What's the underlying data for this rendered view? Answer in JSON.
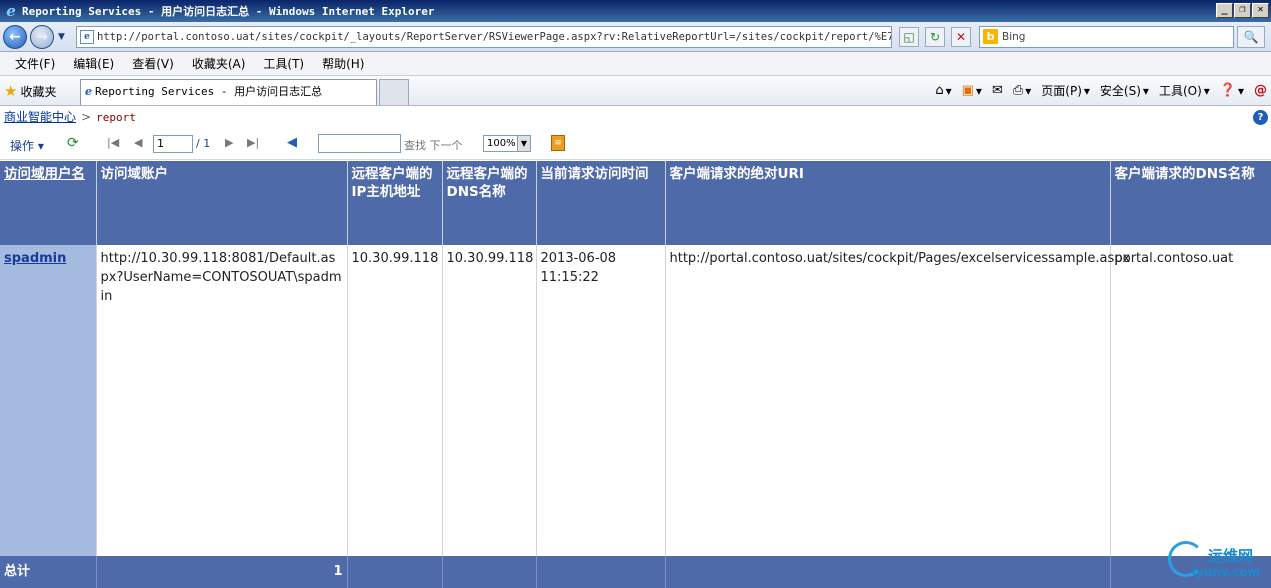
{
  "window": {
    "title": "Reporting Services - 用户访问日志汇总 - Windows Internet Explorer",
    "minimize": "_",
    "restore": "❐",
    "close": "✕"
  },
  "address_bar": {
    "url": "http://portal.contoso.uat/sites/cockpit/_layouts/ReportServer/RSViewerPage.aspx?rv:RelativeReportUrl=/sites/cockpit/report/%E7%94%",
    "search_placeholder": "Bing"
  },
  "menu": {
    "items": [
      "文件(F)",
      "编辑(E)",
      "查看(V)",
      "收藏夹(A)",
      "工具(T)",
      "帮助(H)"
    ]
  },
  "favorites_bar": {
    "favorites_label": "收藏夹",
    "tab_title": "Reporting Services - 用户访问日志汇总",
    "commands": {
      "page": "页面(P)",
      "safety": "安全(S)",
      "tools": "工具(O)"
    }
  },
  "breadcrumb": {
    "root": "商业智能中心",
    "separator": ">",
    "current": "report"
  },
  "report_toolbar": {
    "actions": "操作",
    "page_current": "1",
    "page_total": "/ 1",
    "find_label": "查找",
    "next_label": "下一个",
    "zoom": "100%"
  },
  "table": {
    "headers": [
      "访问域用户名",
      "访问域账户",
      "远程客户端的IP主机地址",
      "远程客户端的DNS名称",
      "当前请求访问时间",
      "客户端请求的绝对URI",
      "客户端请求的DNS名称"
    ],
    "rows": [
      [
        "spadmin",
        "http://10.30.99.118:8081/Default.aspx?UserName=CONTOSOUAT\\spadmin",
        "10.30.99.118",
        "10.30.99.118",
        "2013-06-08 11:15:22",
        "http://portal.contoso.uat/sites/cockpit/Pages/excelservicessample.aspx",
        "portal.contoso.uat"
      ]
    ],
    "total_label": "总计",
    "total_value": "1"
  },
  "watermark": {
    "name": "运维网",
    "url": "iyunv.com"
  }
}
